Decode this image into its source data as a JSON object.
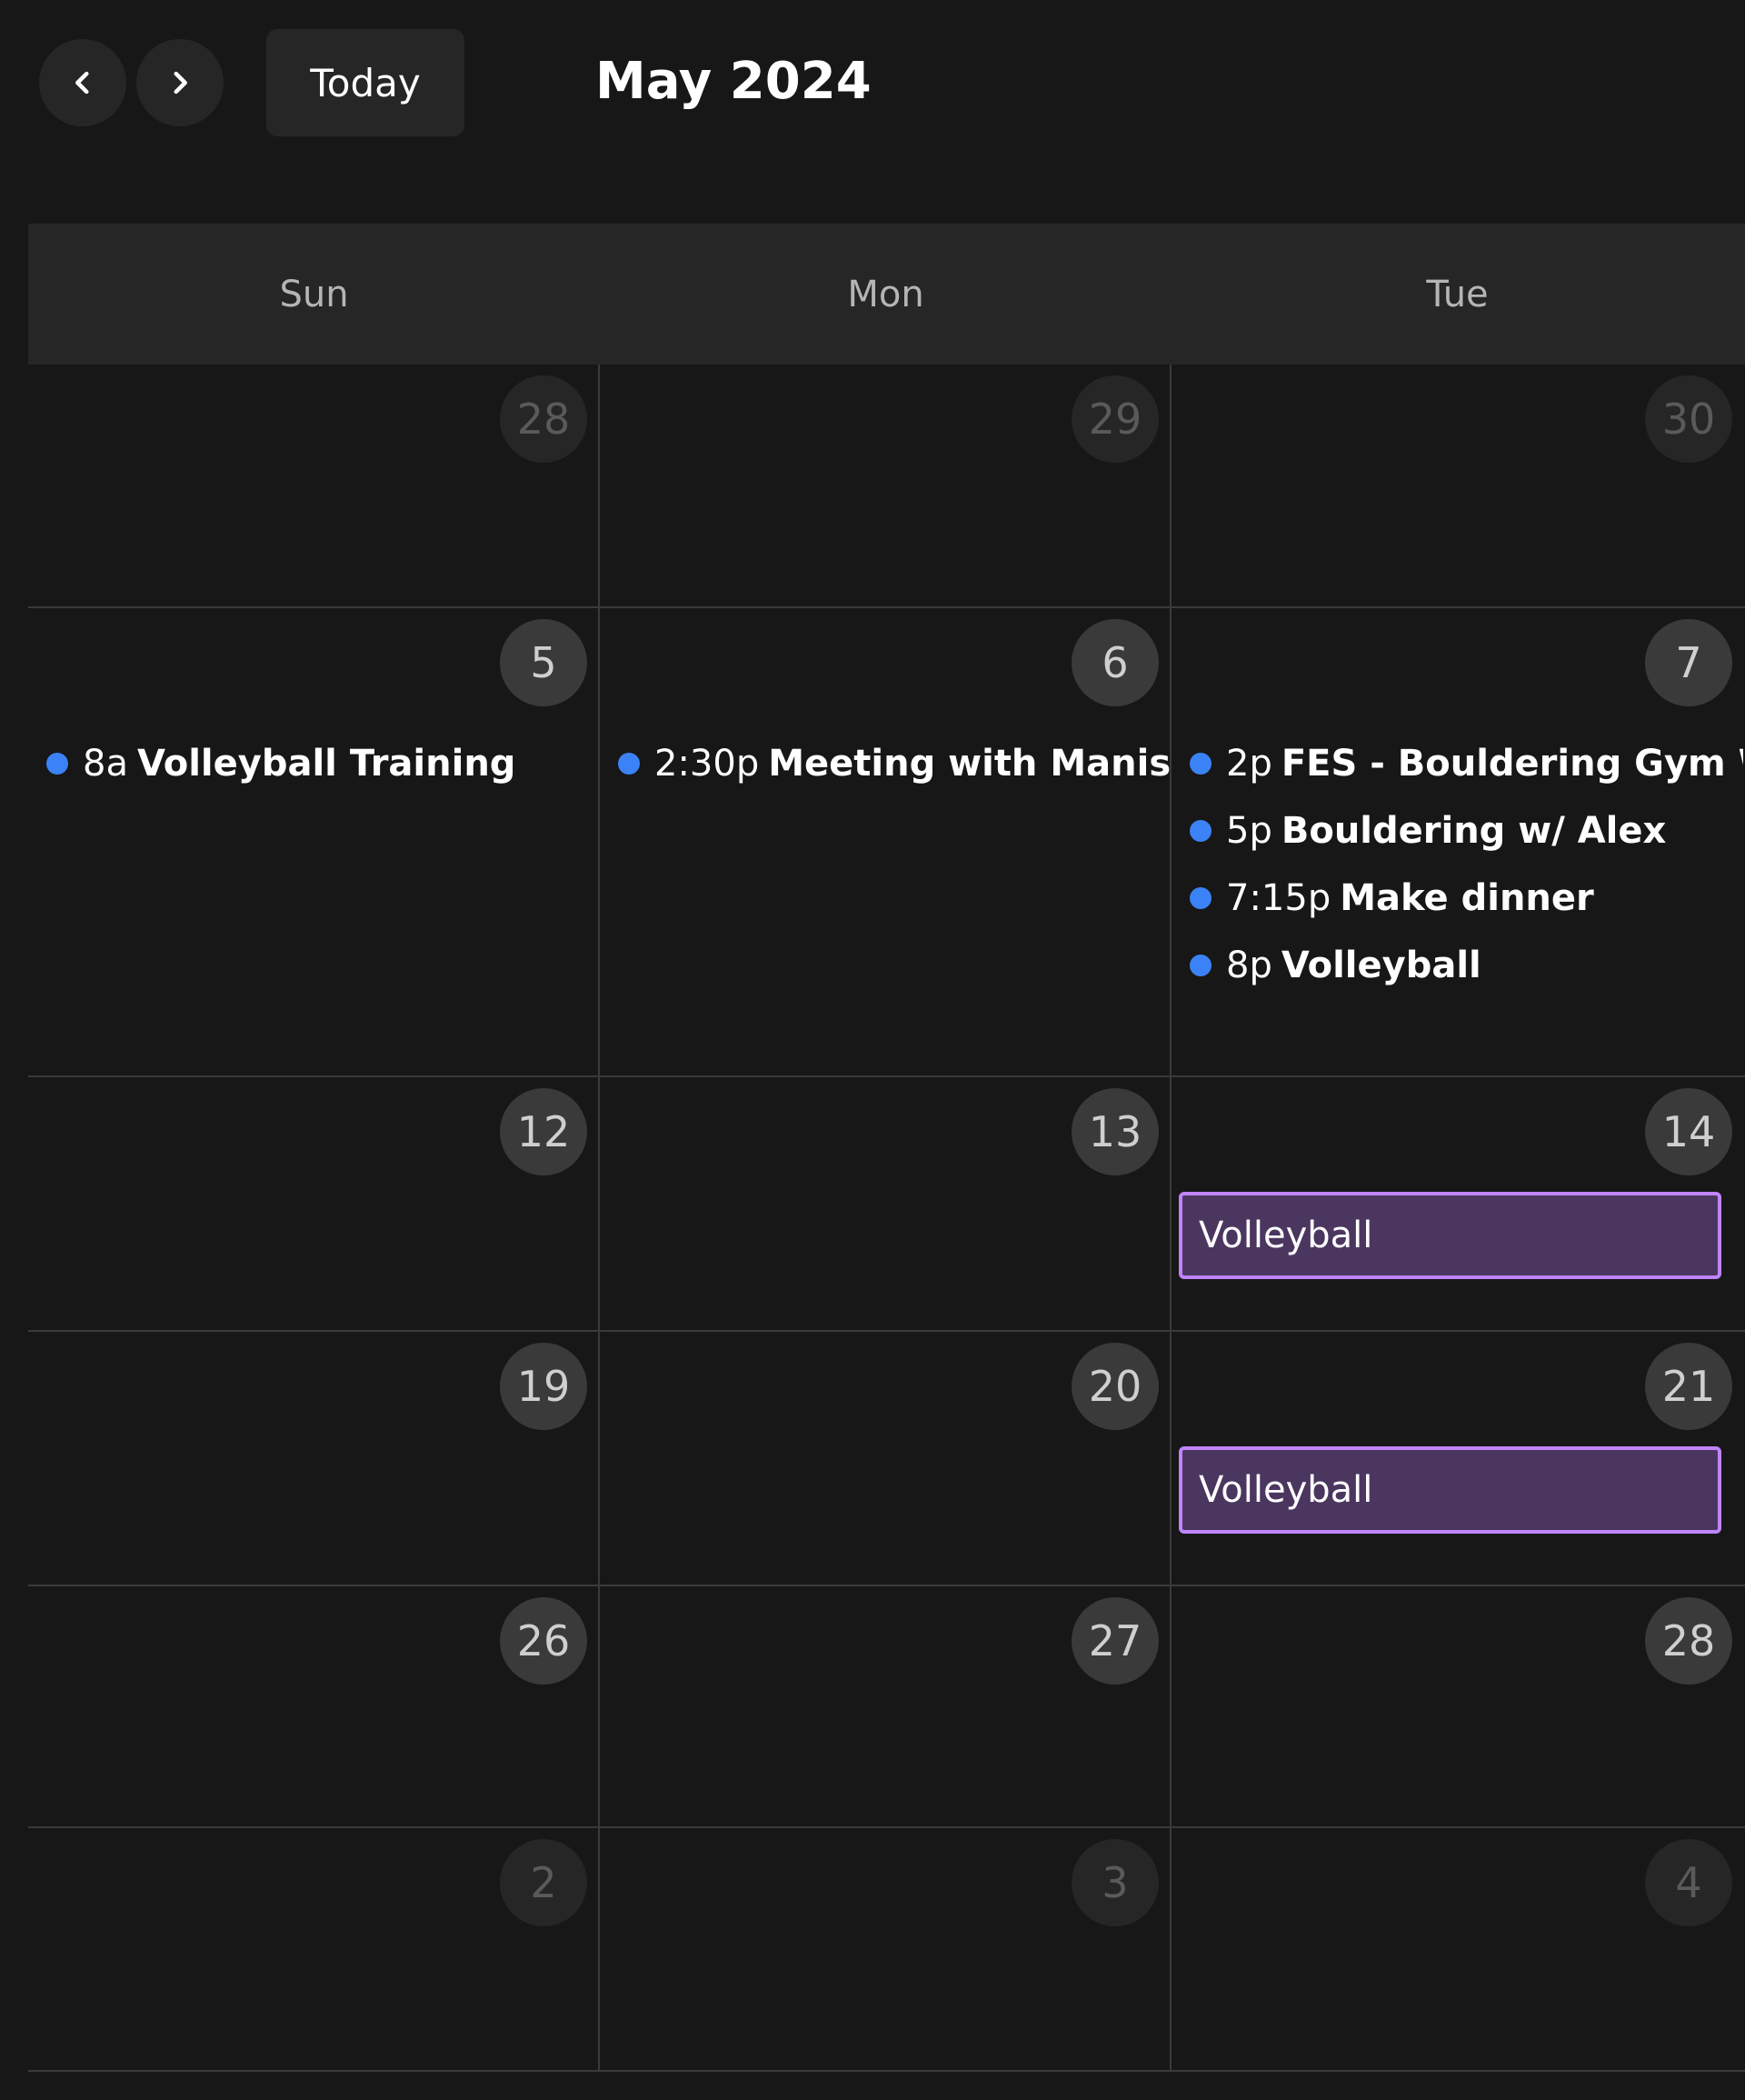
{
  "toolbar": {
    "prev_icon": "chevron-left-icon",
    "next_icon": "chevron-right-icon",
    "today_label": "Today",
    "month_title": "May 2024"
  },
  "weekdays": [
    "Sun",
    "Mon",
    "Tue"
  ],
  "weeks": [
    {
      "days": [
        {
          "num": "28",
          "other": true,
          "events": []
        },
        {
          "num": "29",
          "other": true,
          "events": []
        },
        {
          "num": "30",
          "other": true,
          "events": []
        }
      ]
    },
    {
      "days": [
        {
          "num": "5",
          "other": false,
          "events": [
            {
              "time": "8a",
              "title": "Volleyball Training"
            }
          ]
        },
        {
          "num": "6",
          "other": false,
          "events": [
            {
              "time": "2:30p",
              "title": "Meeting with Manish"
            }
          ]
        },
        {
          "num": "7",
          "other": false,
          "events": [
            {
              "time": "2p",
              "title": "FES - Bouldering Gym We"
            },
            {
              "time": "5p",
              "title": "Bouldering w/ Alex"
            },
            {
              "time": "7:15p",
              "title": "Make dinner"
            },
            {
              "time": "8p",
              "title": "Volleyball"
            }
          ]
        }
      ]
    },
    {
      "days": [
        {
          "num": "12",
          "other": false,
          "events": []
        },
        {
          "num": "13",
          "other": false,
          "events": []
        },
        {
          "num": "14",
          "other": false,
          "events": [],
          "block": "Volleyball"
        }
      ]
    },
    {
      "days": [
        {
          "num": "19",
          "other": false,
          "events": []
        },
        {
          "num": "20",
          "other": false,
          "events": []
        },
        {
          "num": "21",
          "other": false,
          "events": [],
          "block": "Volleyball"
        }
      ]
    },
    {
      "days": [
        {
          "num": "26",
          "other": false,
          "events": []
        },
        {
          "num": "27",
          "other": false,
          "events": []
        },
        {
          "num": "28",
          "other": false,
          "events": []
        }
      ]
    },
    {
      "days": [
        {
          "num": "2",
          "other": true,
          "events": []
        },
        {
          "num": "3",
          "other": true,
          "events": []
        },
        {
          "num": "4",
          "other": true,
          "events": []
        }
      ]
    }
  ],
  "colors": {
    "background": "#171717",
    "header_bg": "#262626",
    "event_dot": "#3b82f6",
    "block_bg": "#4b3660",
    "block_border": "#c084fc"
  }
}
